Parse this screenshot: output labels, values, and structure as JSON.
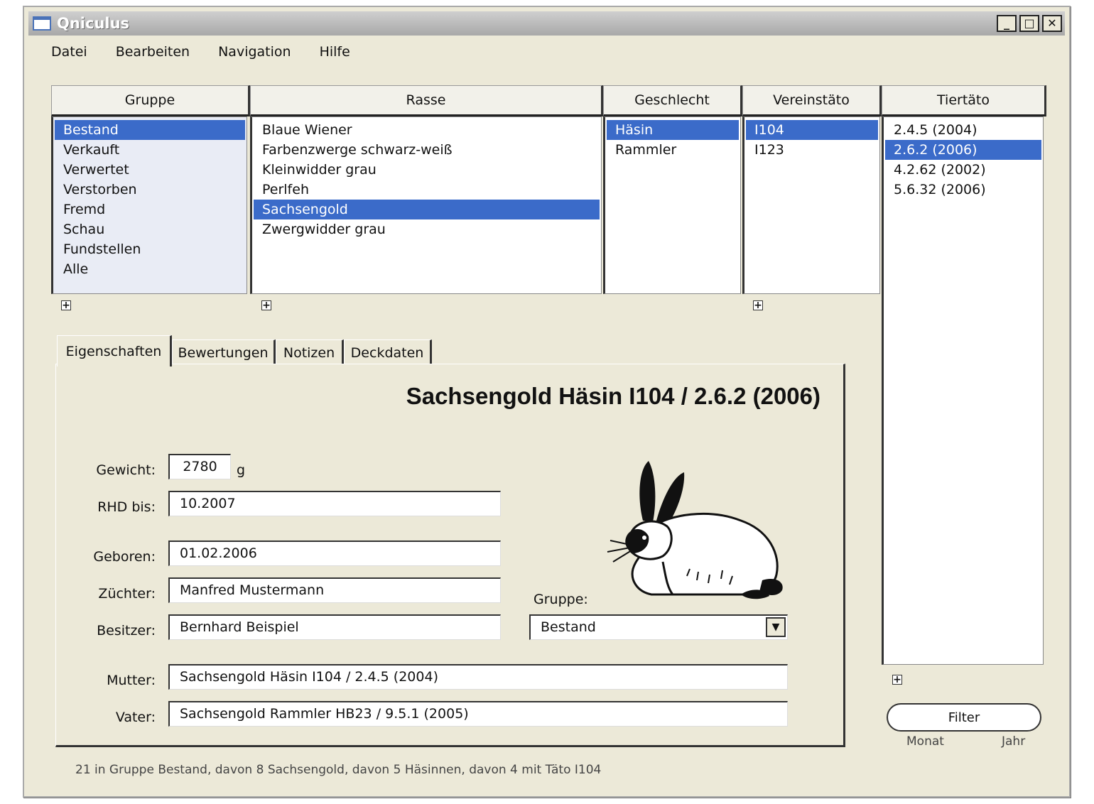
{
  "window": {
    "title": "Qniculus",
    "minimize": "_",
    "maximize": "□",
    "close": "✕"
  },
  "menu": [
    "Datei",
    "Bearbeiten",
    "Navigation",
    "Hilfe"
  ],
  "columns": {
    "gruppe": {
      "header": "Gruppe",
      "items": [
        "Bestand",
        "Verkauft",
        "Verwertet",
        "Verstorben",
        "Fremd",
        "Schau",
        "Fundstellen",
        "Alle"
      ],
      "selected": 0
    },
    "rasse": {
      "header": "Rasse",
      "items": [
        "Blaue Wiener",
        "Farbenzwerge schwarz-weiß",
        "Kleinwidder grau",
        "Perlfeh",
        "Sachsengold",
        "Zwergwidder grau"
      ],
      "selected": 4
    },
    "geschlecht": {
      "header": "Geschlecht",
      "items": [
        "Häsin",
        "Rammler"
      ],
      "selected": 0
    },
    "vereinstaeto": {
      "header": "Vereinstäto",
      "items": [
        "I104",
        "I123"
      ],
      "selected": 0
    },
    "tiertaeto": {
      "header": "Tiertäto",
      "items": [
        "2.4.5 (2004)",
        "2.6.2 (2006)",
        "4.2.62 (2002)",
        "5.6.32 (2006)"
      ],
      "selected": 1
    }
  },
  "plus_symbol": "+",
  "tabs": [
    "Eigenschaften",
    "Bewertungen",
    "Notizen",
    "Deckdaten"
  ],
  "active_tab": 0,
  "details": {
    "headline": "Sachsengold Häsin I104 / 2.6.2 (2006)",
    "gewicht_label": "Gewicht:",
    "gewicht_value": "2780",
    "gewicht_unit": "g",
    "rhd_label": "RHD bis:",
    "rhd_value": "10.2007",
    "geboren_label": "Geboren:",
    "geboren_value": "01.02.2006",
    "zuechter_label": "Züchter:",
    "zuechter_value": "Manfred Mustermann",
    "besitzer_label": "Besitzer:",
    "besitzer_value": "Bernhard Beispiel",
    "gruppe_label": "Gruppe:",
    "gruppe_value": "Bestand",
    "mutter_label": "Mutter:",
    "mutter_value": "Sachsengold Häsin I104 / 2.4.5 (2004)",
    "vater_label": "Vater:",
    "vater_value": "Sachsengold Rammler HB23 / 9.5.1 (2005)"
  },
  "filter": {
    "button": "Filter",
    "monat": "Monat",
    "jahr": "Jahr"
  },
  "status": "21 in Gruppe Bestand, davon 8 Sachsengold, davon 5 Häsinnen, davon 4 mit Täto I104"
}
